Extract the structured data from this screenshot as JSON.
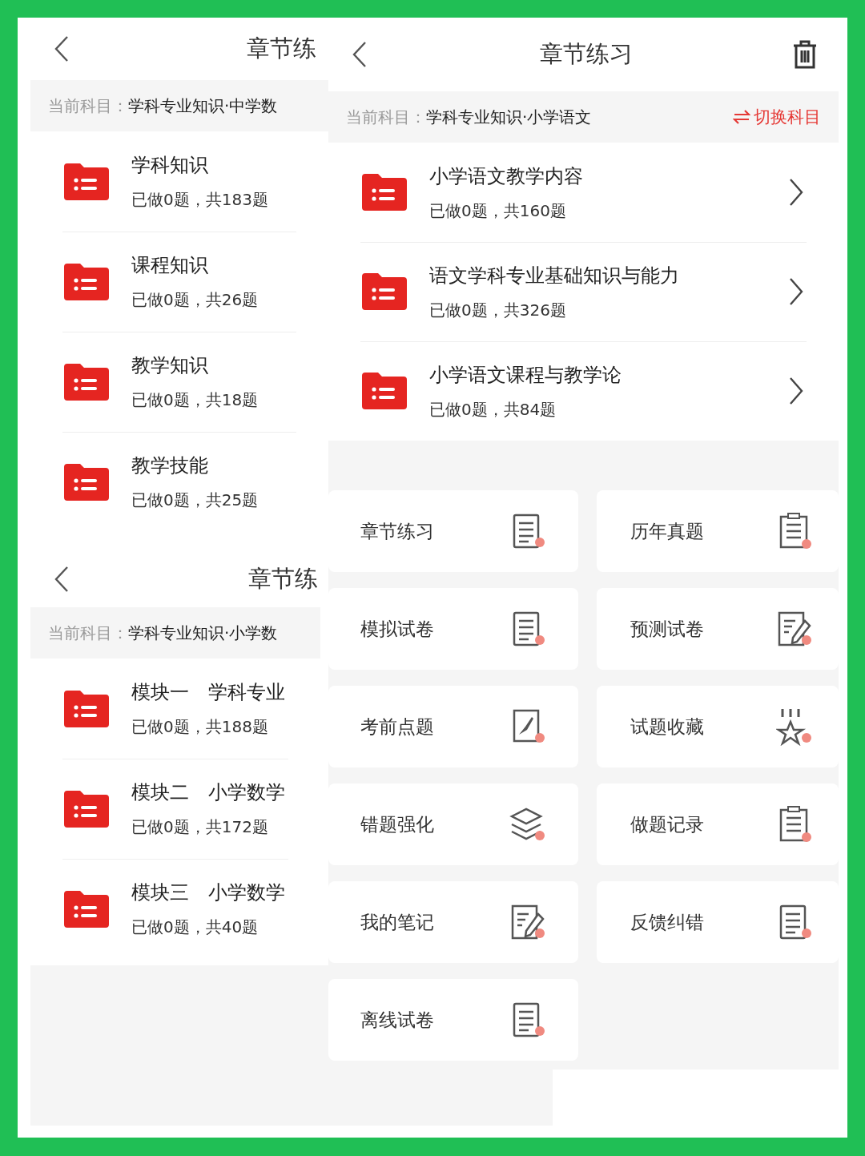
{
  "screens": [
    {
      "title": "章节练",
      "subject_label": "当前科目：",
      "subject": "学科专业知识·中学数",
      "chapters": [
        {
          "name": "学科知识",
          "count": "已做0题，共183题"
        },
        {
          "name": "课程知识",
          "count": "已做0题，共26题"
        },
        {
          "name": "教学知识",
          "count": "已做0题，共18题"
        },
        {
          "name": "教学技能",
          "count": "已做0题，共25题"
        }
      ]
    },
    {
      "title": "章节练习",
      "subject_label": "当前科目：",
      "subject": "学科专业知识·小学语文",
      "switch_label": "切换科目",
      "chapters": [
        {
          "name": "小学语文教学内容",
          "count": "已做0题，共160题"
        },
        {
          "name": "语文学科专业基础知识与能力",
          "count": "已做0题，共326题"
        },
        {
          "name": "小学语文课程与教学论",
          "count": "已做0题，共84题"
        }
      ],
      "tools": [
        "章节练习",
        "历年真题",
        "模拟试卷",
        "预测试卷",
        "考前点题",
        "试题收藏",
        "错题强化",
        "做题记录",
        "我的笔记",
        "反馈纠错",
        "离线试卷"
      ]
    },
    {
      "title": "章节练",
      "subject_label": "当前科目：",
      "subject": "学科专业知识·小学数",
      "chapters": [
        {
          "name": "模块一　学科专业",
          "count": "已做0题，共188题"
        },
        {
          "name": "模块二　小学数学",
          "count": "已做0题，共172题"
        },
        {
          "name": "模块三　小学数学",
          "count": "已做0题，共40题"
        }
      ]
    }
  ]
}
